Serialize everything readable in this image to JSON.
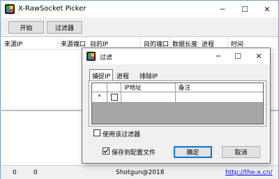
{
  "window": {
    "title": "X-RawSocket Picker",
    "minimize": "─",
    "maximize": "☐",
    "close": "✕"
  },
  "toolbar": {
    "start_label": "开始",
    "filter_label": "过滤器"
  },
  "columns": [
    "来源IP",
    "来源端口",
    "目的IP",
    "目的端口",
    "数据长度",
    "进程",
    "时间"
  ],
  "status": {
    "count1": "0",
    "count2": "0",
    "credit": "Shotgun@2018",
    "link": "http://the-x.cn/"
  },
  "dialog": {
    "title": "过滤",
    "minimize": "─",
    "maximize": "☐",
    "close": "✕",
    "tabs": [
      "捕捉IP",
      "进程",
      "排除IP"
    ],
    "active_tab": 0,
    "grid": {
      "headers": [
        "",
        "",
        "IP地址",
        "备注"
      ],
      "new_row_marker": "*",
      "checkbox_checked": false
    },
    "use_filter_label": "使用该过滤器",
    "use_filter_checked": false,
    "save_config_label": "保存到配置文件",
    "save_config_checked": true,
    "ok_label": "确定",
    "cancel_label": "取消"
  },
  "icons": {
    "app": "app-icon",
    "dialog": "dialog-app-icon"
  }
}
